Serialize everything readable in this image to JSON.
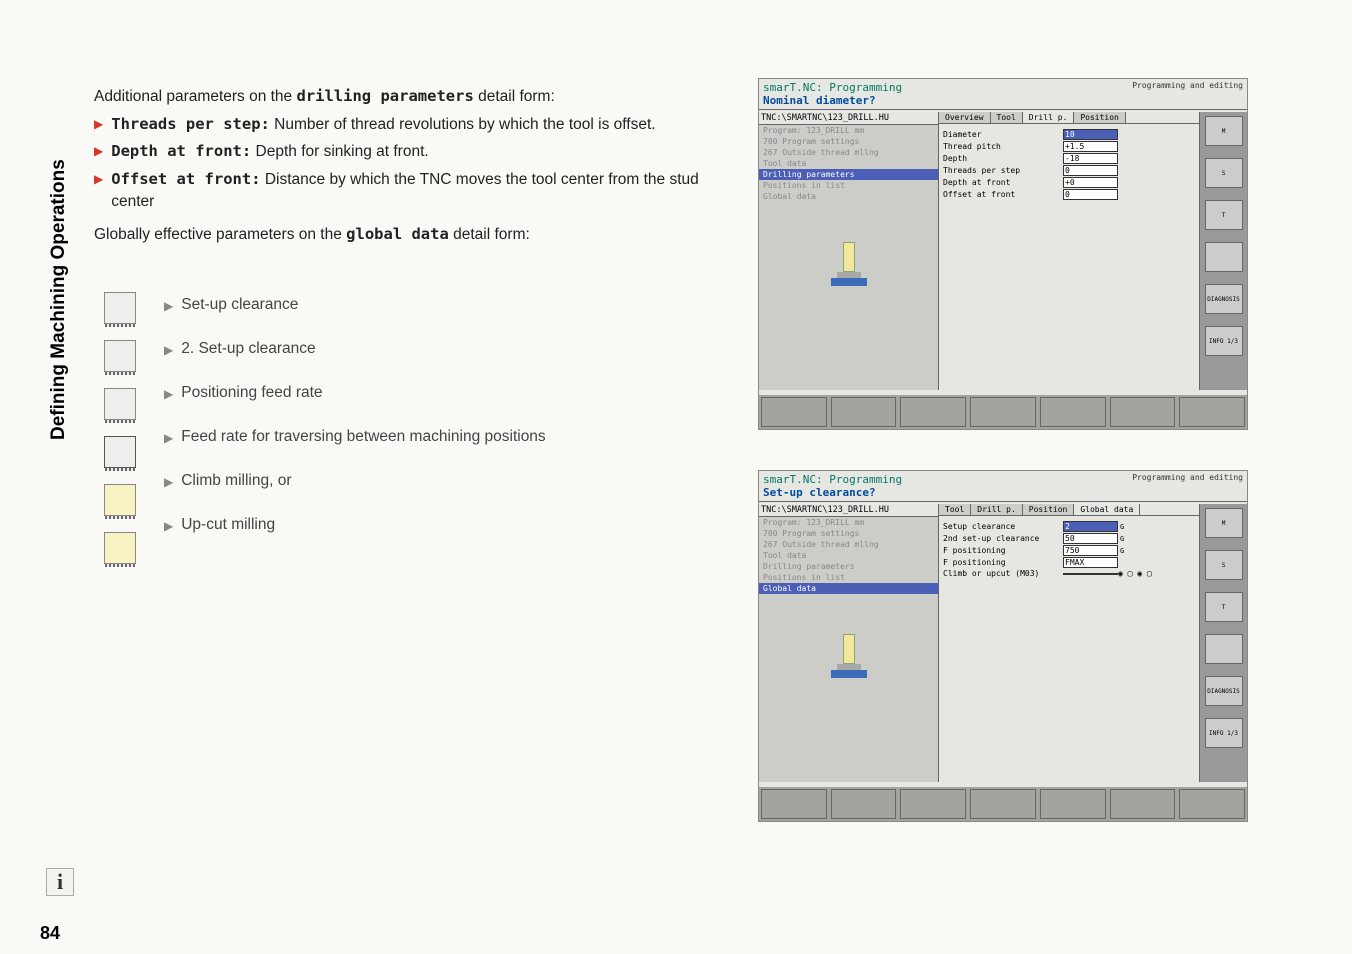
{
  "sidebarTitle": "Defining Machining Operations",
  "pageNumber": "84",
  "infoGlyph": "i",
  "intro": {
    "line1_a": "Additional parameters on the ",
    "line1_b": "drilling parameters",
    "line1_c": " detail form:"
  },
  "bullets": [
    {
      "bold": "Threads per step:",
      "rest": " Number of thread revolutions by which the tool is offset."
    },
    {
      "bold": "Depth at front:",
      "rest": " Depth for sinking at front."
    },
    {
      "bold": "Offset at front:",
      "rest": " Distance by which the TNC moves the tool center from the stud center"
    }
  ],
  "global": {
    "line_a": "Globally effective parameters on the ",
    "line_b": "global data",
    "line_c": " detail form:"
  },
  "globalList": [
    "Set-up clearance",
    "2. Set-up clearance",
    "Positioning feed rate",
    "Feed rate for traversing between machining positions",
    "Climb milling, or",
    "Up-cut milling"
  ],
  "screenshotA": {
    "app": "smarT.NC: Programming",
    "subtitle": "Nominal diameter?",
    "mode": "Programming and editing",
    "path": "TNC:\\SMARTNC\\123_DRILL.HU",
    "tree": [
      "Program: 123_DRILL mm",
      "700 Program settings",
      "267 Outside thread mllng",
      "Tool data",
      "Drilling parameters",
      "Positions in list",
      "Global data"
    ],
    "treeSelectedIndex": 4,
    "tabs": [
      "Overview",
      "Tool",
      "Drill p.",
      "Position"
    ],
    "activeTab": 2,
    "fields": [
      {
        "lbl": "Diameter",
        "val": "10",
        "hi": true
      },
      {
        "lbl": "Thread pitch",
        "val": "+1.5"
      },
      {
        "lbl": "Depth",
        "val": "-18"
      },
      {
        "lbl": "Threads per step",
        "val": "0"
      },
      {
        "lbl": "Depth at front",
        "val": "+0"
      },
      {
        "lbl": "Offset at front",
        "val": "0"
      }
    ],
    "sidebarLabels": [
      "M",
      "S",
      "T",
      "",
      "DIAGNOSIS",
      "INFO 1/3"
    ]
  },
  "screenshotB": {
    "app": "smarT.NC: Programming",
    "subtitle": "Set-up clearance?",
    "mode": "Programming and editing",
    "path": "TNC:\\SMARTNC\\123_DRILL.HU",
    "tree": [
      "Program: 123_DRILL mm",
      "700 Program settings",
      "267 Outside thread mllng",
      "Tool data",
      "Drilling parameters",
      "Positions in list",
      "Global data"
    ],
    "treeSelectedIndex": 6,
    "tabs": [
      "Tool",
      "Drill p.",
      "Position",
      "Global data"
    ],
    "activeTab": 3,
    "fields": [
      {
        "lbl": "Setup clearance",
        "val": "2",
        "hi": true,
        "g": true
      },
      {
        "lbl": "2nd set-up clearance",
        "val": "50",
        "g": true
      },
      {
        "lbl": "F positioning",
        "val": "750",
        "g": true
      },
      {
        "lbl": "F positioning",
        "val": "FMAX"
      },
      {
        "lbl": "Climb or upcut (M03)",
        "val": "",
        "icons": true
      }
    ],
    "sidebarLabels": [
      "M",
      "S",
      "T",
      "",
      "DIAGNOSIS",
      "INFO 1/3"
    ]
  }
}
